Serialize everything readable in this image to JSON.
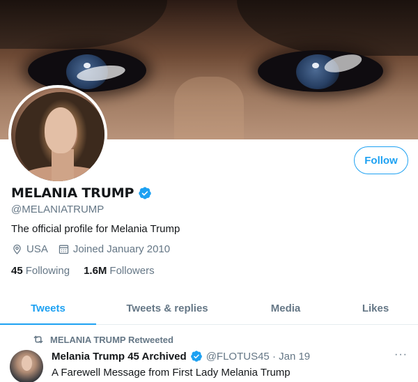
{
  "profile": {
    "display_name": "MELANIA TRUMP",
    "handle": "@MELANIATRUMP",
    "bio": "The official profile for Melania Trump",
    "location": "USA",
    "joined": "Joined January 2010",
    "following_count": "45",
    "following_label": "Following",
    "followers_count": "1.6M",
    "followers_label": "Followers",
    "follow_label": "Follow"
  },
  "tabs": [
    {
      "label": "Tweets",
      "active": true
    },
    {
      "label": "Tweets & replies",
      "active": false
    },
    {
      "label": "Media",
      "active": false
    },
    {
      "label": "Likes",
      "active": false
    }
  ],
  "tweet": {
    "retweet_label": "MELANIA TRUMP Retweeted",
    "author_name": "Melania Trump 45 Archived",
    "author_handle_date": "@FLOTUS45 · Jan 19",
    "text": "A Farewell Message from First Lady Melania Trump",
    "more": "···"
  },
  "colors": {
    "accent": "#1da1f2",
    "muted": "#657786",
    "text": "#14171a"
  },
  "icons": {
    "verified": "verified-badge-icon",
    "location": "location-pin-icon",
    "calendar": "calendar-icon",
    "retweet": "retweet-icon",
    "more": "more-dots-icon"
  }
}
